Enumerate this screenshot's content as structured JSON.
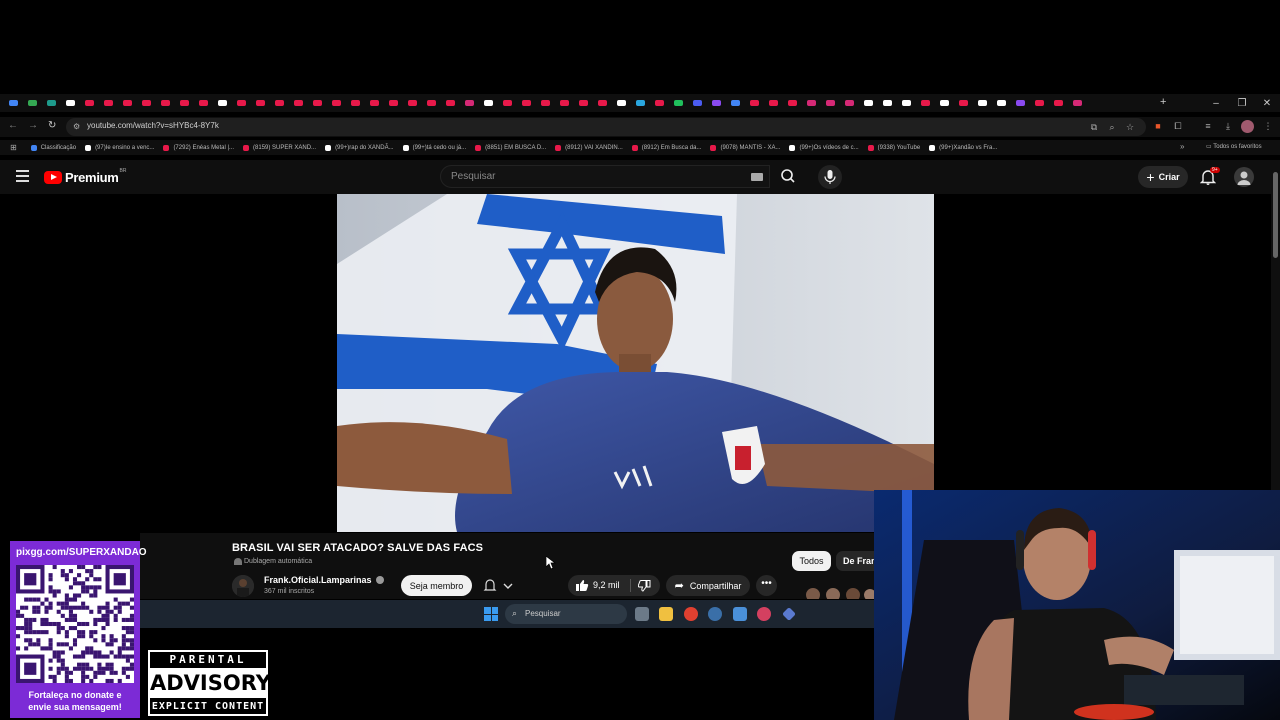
{
  "browser": {
    "url": "youtube.com/watch?v=sHYBc4-8Y7k",
    "tab_colors": [
      "#4285f4",
      "#34a853",
      "#1e9b8c",
      "#ffffff",
      "#e8194a",
      "#e8194a",
      "#e8194a",
      "#e8194a",
      "#e8194a",
      "#e8194a",
      "#e8194a",
      "#ffffff",
      "#e8194a",
      "#e8194a",
      "#e8194a",
      "#e8194a",
      "#e8194a",
      "#e8194a",
      "#e8194a",
      "#e8194a",
      "#e8194a",
      "#e8194a",
      "#e8194a",
      "#e8194a",
      "#d62976",
      "#ffffff",
      "#e8194a",
      "#e8194a",
      "#e8194a",
      "#e8194a",
      "#e8194a",
      "#e8194a",
      "#ffffff",
      "#2aa7e0",
      "#e8194a",
      "#20c05c",
      "#4b5cf0",
      "#8a4af0",
      "#4285f4",
      "#e8194a",
      "#e8194a",
      "#e8194a",
      "#d62976",
      "#d62976",
      "#d62976",
      "#ffffff",
      "#ffffff",
      "#ffffff",
      "#e8194a",
      "#ffffff",
      "#e8194a",
      "#ffffff",
      "#ffffff",
      "#8a4af0",
      "#e8194a",
      "#e8194a",
      "#d62976"
    ],
    "new_tab": "+",
    "minimize": "–",
    "maximize": "❐",
    "close": "✕",
    "bookmarks": [
      {
        "label": "Classificação",
        "color": "#4285f4"
      },
      {
        "label": "(97)Ie ensino a venc...",
        "color": "#ffffff"
      },
      {
        "label": "(7292) Enéas Metal |...",
        "color": "#e8194a"
      },
      {
        "label": "(8159) SUPER XAND...",
        "color": "#e8194a"
      },
      {
        "label": "(99+)rap do XANDÃ...",
        "color": "#ffffff"
      },
      {
        "label": "(99+)tá cedo ou já...",
        "color": "#ffffff"
      },
      {
        "label": "(8851) EM BUSCA D...",
        "color": "#e8194a"
      },
      {
        "label": "(8912) VAI XANDIN...",
        "color": "#e8194a"
      },
      {
        "label": "(8912) Em Busca da...",
        "color": "#e8194a"
      },
      {
        "label": "(9078) MANTIS - XA...",
        "color": "#e8194a"
      },
      {
        "label": "(99+)Os vídeos de c...",
        "color": "#ffffff"
      },
      {
        "label": "(9338) YouTube",
        "color": "#e8194a"
      },
      {
        "label": "(99+)Xandão vs Fra...",
        "color": "#ffffff"
      }
    ],
    "all_bookmarks": "Todos os favoritos",
    "more_bookmarks": "»"
  },
  "youtube": {
    "brand": "Premium",
    "country": "BR",
    "search_placeholder": "Pesquisar",
    "create_label": "Criar",
    "notif_badge": "9+",
    "video": {
      "title": "BRASIL VAI SER ATACADO? SALVE DAS FACS",
      "dub_label": "Dublagem automática",
      "channel": "Frank.Oficial.Lamparinas",
      "subscribers": "367 mil inscritos",
      "join_label": "Seja membro",
      "likes": "9,2 mil",
      "share_label": "Compartilhar",
      "more_label": "•••"
    },
    "chips": [
      "Todos",
      "De Frank"
    ]
  },
  "taskbar": {
    "search_placeholder": "Pesquisar"
  },
  "overlay": {
    "qr_url": "pixgg.com/SUPERXANDAO",
    "qr_text_line1": "Fortaleça no donate e",
    "qr_text_line2": "envie sua mensagem!",
    "advisory_line1": "PARENTAL",
    "advisory_line2": "ADVISORY",
    "advisory_line3": "EXPLICIT CONTENT"
  }
}
